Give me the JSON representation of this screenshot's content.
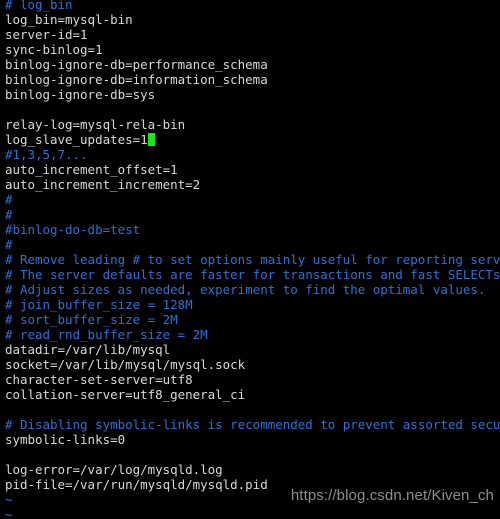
{
  "terminal": {
    "background_color": "#000000",
    "text_color": "#d8d8d8",
    "comment_color": "#2d6fd6",
    "cursor_color": "#15e815",
    "cursor_line_index": 9,
    "cursor_column": 20,
    "lines": [
      {
        "text": "# log_bin",
        "kind": "comment"
      },
      {
        "text": "log_bin=mysql-bin",
        "kind": "text"
      },
      {
        "text": "server-id=1",
        "kind": "text"
      },
      {
        "text": "sync-binlog=1",
        "kind": "text"
      },
      {
        "text": "binlog-ignore-db=performance_schema",
        "kind": "text"
      },
      {
        "text": "binlog-ignore-db=information_schema",
        "kind": "text"
      },
      {
        "text": "binlog-ignore-db=sys",
        "kind": "text"
      },
      {
        "text": "",
        "kind": "blank"
      },
      {
        "text": "relay-log=mysql-rela-bin",
        "kind": "text"
      },
      {
        "text": "log_slave_updates=1",
        "kind": "text-cursor"
      },
      {
        "text": "#1,3,5,7...",
        "kind": "comment"
      },
      {
        "text": "auto_increment_offset=1",
        "kind": "text"
      },
      {
        "text": "auto_increment_increment=2",
        "kind": "text"
      },
      {
        "text": "#",
        "kind": "comment"
      },
      {
        "text": "#",
        "kind": "comment"
      },
      {
        "text": "#binlog-do-db=test",
        "kind": "comment"
      },
      {
        "text": "#",
        "kind": "comment"
      },
      {
        "text": "# Remove leading # to set options mainly useful for reporting servers.",
        "kind": "comment"
      },
      {
        "text": "# The server defaults are faster for transactions and fast SELECTs.",
        "kind": "comment"
      },
      {
        "text": "# Adjust sizes as needed, experiment to find the optimal values.",
        "kind": "comment"
      },
      {
        "text": "# join_buffer_size = 128M",
        "kind": "comment"
      },
      {
        "text": "# sort_buffer_size = 2M",
        "kind": "comment"
      },
      {
        "text": "# read_rnd_buffer_size = 2M",
        "kind": "comment"
      },
      {
        "text": "datadir=/var/lib/mysql",
        "kind": "text"
      },
      {
        "text": "socket=/var/lib/mysql/mysql.sock",
        "kind": "text"
      },
      {
        "text": "character-set-server=utf8",
        "kind": "text"
      },
      {
        "text": "collation-server=utf8_general_ci",
        "kind": "text"
      },
      {
        "text": "",
        "kind": "blank"
      },
      {
        "text": "# Disabling symbolic-links is recommended to prevent assorted security",
        "kind": "comment"
      },
      {
        "text": "symbolic-links=0",
        "kind": "text"
      },
      {
        "text": "",
        "kind": "blank"
      },
      {
        "text": "log-error=/var/log/mysqld.log",
        "kind": "text"
      },
      {
        "text": "pid-file=/var/run/mysqld/mysqld.pid",
        "kind": "text"
      },
      {
        "text": "~",
        "kind": "tilde"
      },
      {
        "text": "~",
        "kind": "tilde"
      }
    ]
  },
  "watermark": {
    "text": "https://blog.csdn.net/Kiven_ch",
    "color": "#8d8d8d"
  }
}
